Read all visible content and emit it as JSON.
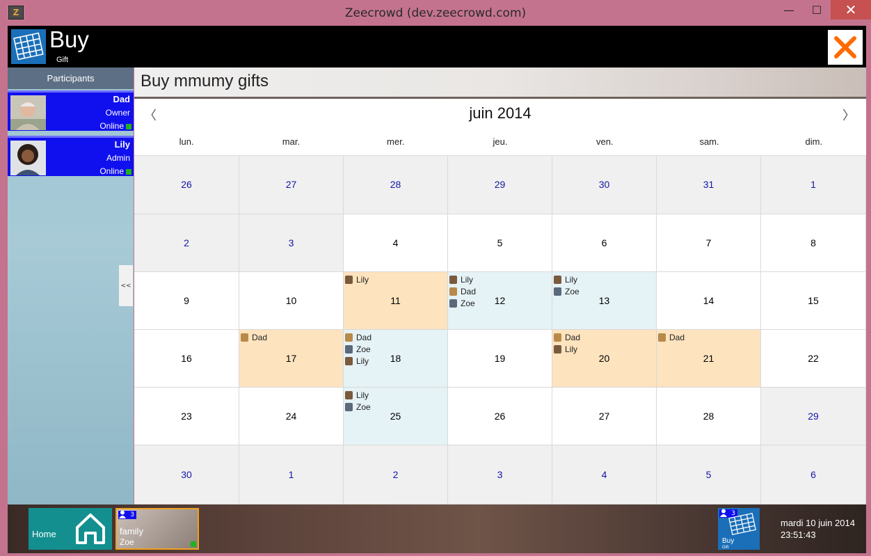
{
  "window": {
    "title": "Zeecrowd (dev.zeecrowd.com)",
    "minimize": "—",
    "maximize": "☐",
    "close": "✕",
    "app_icon": "Z"
  },
  "header": {
    "title": "Buy",
    "subtitle": "Gift",
    "close_color": "#ff6a00"
  },
  "sidebar": {
    "heading": "Participants",
    "collapse_label": "<<",
    "participants": [
      {
        "name": "Dad",
        "role": "Owner",
        "status": "Online"
      },
      {
        "name": "Lily",
        "role": "Admin",
        "status": "Online"
      }
    ]
  },
  "main": {
    "title": "Buy mmumy gifts"
  },
  "calendar": {
    "month_label": "juin 2014",
    "prev": "〈",
    "next": "〉",
    "weekdays": [
      "lun.",
      "mar.",
      "mer.",
      "jeu.",
      "ven.",
      "sam.",
      "dim."
    ],
    "weeks": [
      [
        {
          "day": "26",
          "other": true
        },
        {
          "day": "27",
          "other": true
        },
        {
          "day": "28",
          "other": true
        },
        {
          "day": "29",
          "other": true
        },
        {
          "day": "30",
          "other": true
        },
        {
          "day": "31",
          "other": true
        },
        {
          "day": "1",
          "other": true
        }
      ],
      [
        {
          "day": "2",
          "other": true
        },
        {
          "day": "3",
          "other": true
        },
        {
          "day": "4"
        },
        {
          "day": "5"
        },
        {
          "day": "6"
        },
        {
          "day": "7"
        },
        {
          "day": "8"
        }
      ],
      [
        {
          "day": "9"
        },
        {
          "day": "10"
        },
        {
          "day": "11",
          "hl": "orange",
          "events": [
            "Lily"
          ]
        },
        {
          "day": "12",
          "hl": "blue",
          "events": [
            "Lily",
            "Dad",
            "Zoe"
          ]
        },
        {
          "day": "13",
          "hl": "blue",
          "events": [
            "Lily",
            "Zoe"
          ]
        },
        {
          "day": "14"
        },
        {
          "day": "15"
        }
      ],
      [
        {
          "day": "16"
        },
        {
          "day": "17",
          "hl": "orange",
          "events": [
            "Dad"
          ]
        },
        {
          "day": "18",
          "hl": "blue",
          "events": [
            "Dad",
            "Zoe",
            "Lily"
          ]
        },
        {
          "day": "19"
        },
        {
          "day": "20",
          "hl": "orange",
          "events": [
            "Dad",
            "Lily"
          ]
        },
        {
          "day": "21",
          "hl": "orange",
          "events": [
            "Dad"
          ]
        },
        {
          "day": "22"
        }
      ],
      [
        {
          "day": "23"
        },
        {
          "day": "24"
        },
        {
          "day": "25",
          "hl": "blue",
          "events": [
            "Lily",
            "Zoe"
          ]
        },
        {
          "day": "26"
        },
        {
          "day": "27"
        },
        {
          "day": "28"
        },
        {
          "day": "29",
          "other": true
        }
      ],
      [
        {
          "day": "30",
          "other": true
        },
        {
          "day": "1",
          "other": true
        },
        {
          "day": "2",
          "other": true
        },
        {
          "day": "3",
          "other": true
        },
        {
          "day": "4",
          "other": true
        },
        {
          "day": "5",
          "other": true
        },
        {
          "day": "6",
          "other": true
        }
      ]
    ]
  },
  "taskbar": {
    "home_label": "Home",
    "family": {
      "name": "family",
      "user": "Zoe",
      "badge": "3"
    },
    "buy": {
      "label": "Buy",
      "sub": "Gift",
      "badge": "3"
    },
    "clock": {
      "date": "mardi 10 juin 2014",
      "time": "23:51:43"
    }
  }
}
